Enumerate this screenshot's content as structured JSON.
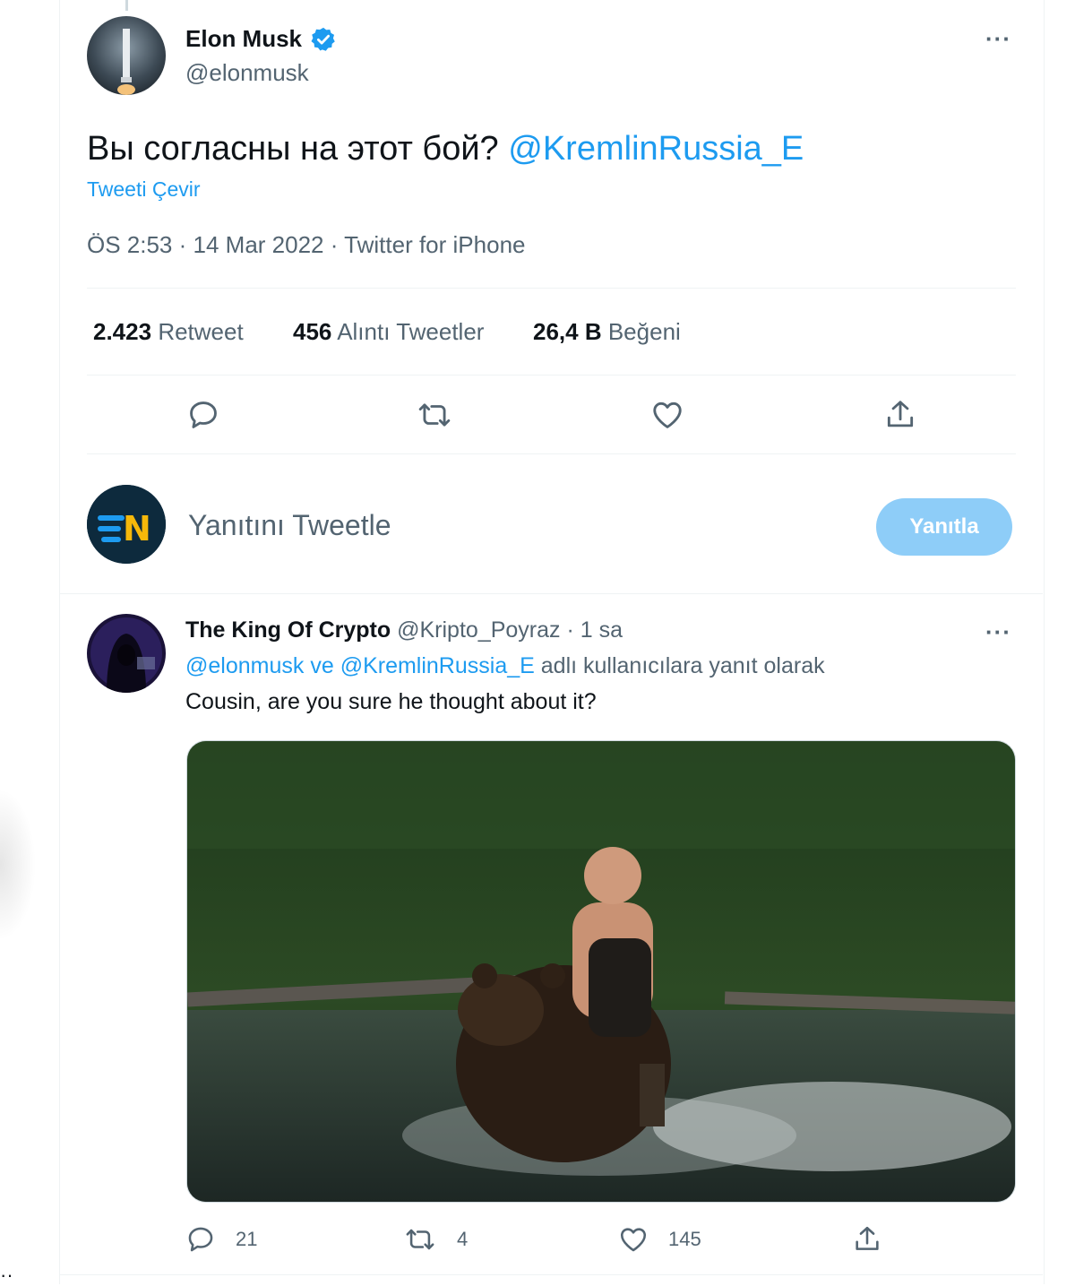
{
  "main_tweet": {
    "author_name": "Elon Musk",
    "author_handle": "@elonmusk",
    "verified_icon": "verified-badge-icon",
    "text": "Вы согласны на этот бой?",
    "mention": "@KremlinRussia_E",
    "translate_label": "Tweeti Çevir",
    "time": "ÖS 2:53",
    "date": "14 Mar 2022",
    "source": "Twitter for iPhone",
    "stats": {
      "retweets_count": "2.423",
      "retweets_label": "Retweet",
      "quotes_count": "456",
      "quotes_label": "Alıntı Tweetler",
      "likes_count": "26,4 B",
      "likes_label": "Beğeni"
    },
    "actions": [
      "reply-icon",
      "retweet-icon",
      "like-icon",
      "share-icon"
    ]
  },
  "compose": {
    "placeholder": "Yanıtını Tweetle",
    "button_label": "Yanıtla",
    "avatar_letter": "N"
  },
  "reply": {
    "author_name": "The King Of Crypto",
    "author_handle": "@Kripto_Poyraz",
    "time": "1 sa",
    "replying_to_user1": "@elonmusk",
    "replying_to_joiner": "ve",
    "replying_to_user2": "@KremlinRussia_E",
    "replying_suffix": "adlı kullanıcılara yanıt olarak",
    "text": "Cousin, are you sure he thought about it?",
    "replies_count": "21",
    "retweets_count": "4",
    "likes_count": "145"
  },
  "colors": {
    "accent": "#1d9bf0",
    "button_disabled": "#8ecdf8",
    "muted_text": "#536471",
    "divider": "#eff3f4"
  }
}
